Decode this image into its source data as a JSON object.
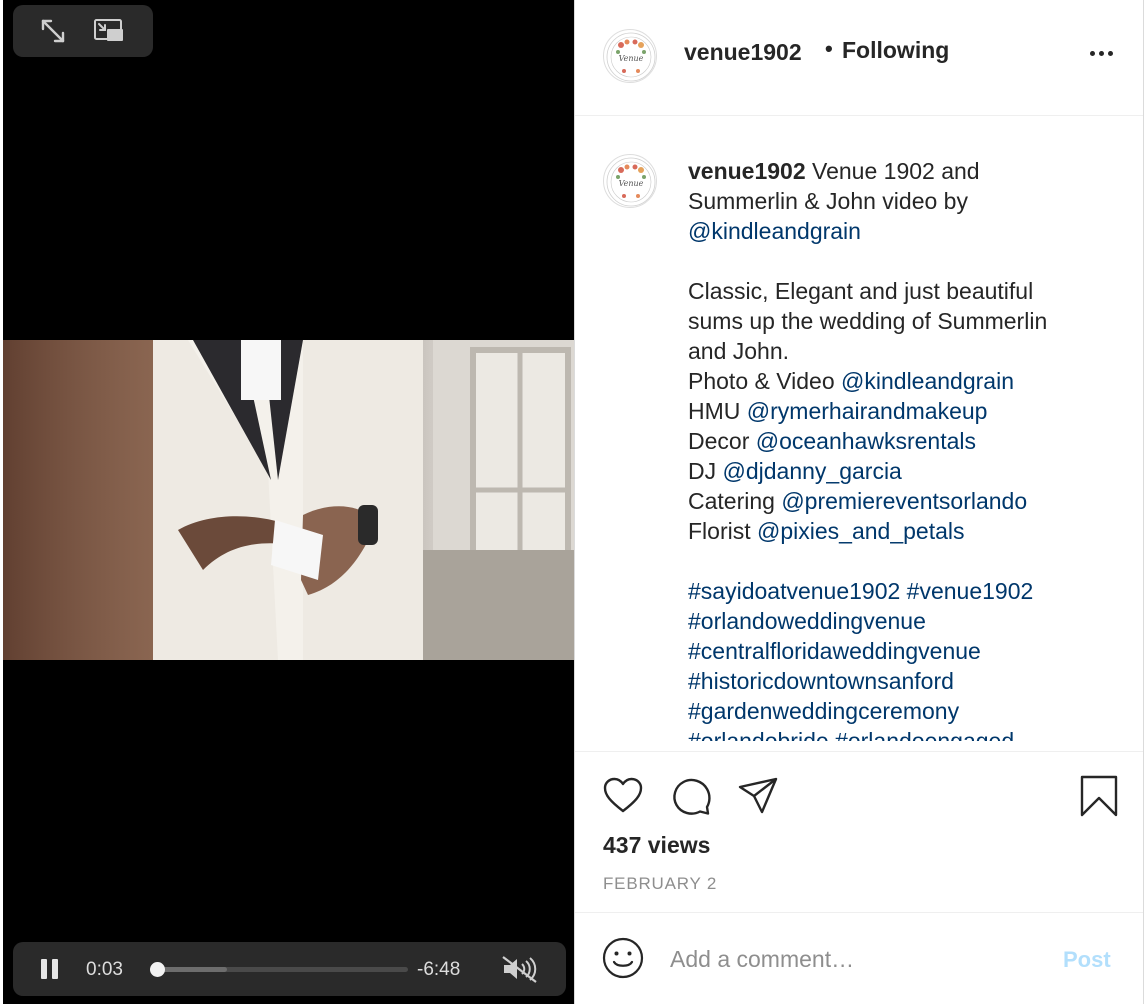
{
  "video": {
    "current_time": "0:03",
    "remaining_time": "-6:48",
    "progress_fraction": 0.0073,
    "buffered_fraction": 0.3,
    "playing": true,
    "muted": true
  },
  "header": {
    "username": "venue1902",
    "separator": "•",
    "follow_state": "Following"
  },
  "caption": {
    "username": "venue1902",
    "intro": " Venue 1902 and",
    "intro_line2": "Summerlin & John video by",
    "intro_link": "@kindleandgrain",
    "paragraph": [
      "Classic, Elegant and just beautiful",
      "sums up the wedding of Summerlin",
      "and John."
    ],
    "credits": [
      {
        "label": "Photo & Video ",
        "handle": "@kindleandgrain"
      },
      {
        "label": "HMU ",
        "handle": "@rymerhairandmakeup"
      },
      {
        "label": "Decor ",
        "handle": "@oceanhawksrentals"
      },
      {
        "label": "DJ ",
        "handle": "@djdanny_garcia"
      },
      {
        "label": "Catering ",
        "handle": "@premiereventsorlando"
      },
      {
        "label": "Florist ",
        "handle": "@pixies_and_petals"
      }
    ],
    "hashtag_lines": [
      "#sayidoatvenue1902 #venue1902",
      "#orlandoweddingvenue",
      "#centralfloridaweddingvenue",
      "#historicdowntownsanford",
      "#gardenweddingceremony",
      "#orlandobride #orlandoengaged"
    ]
  },
  "actions": {
    "views": "437 views",
    "date": "FEBRUARY 2"
  },
  "comment": {
    "placeholder": "Add a comment…",
    "post_label": "Post"
  },
  "colors": {
    "link": "#00376b",
    "post_disabled": "#b2dffc",
    "muted_text": "#8e8e8e"
  }
}
